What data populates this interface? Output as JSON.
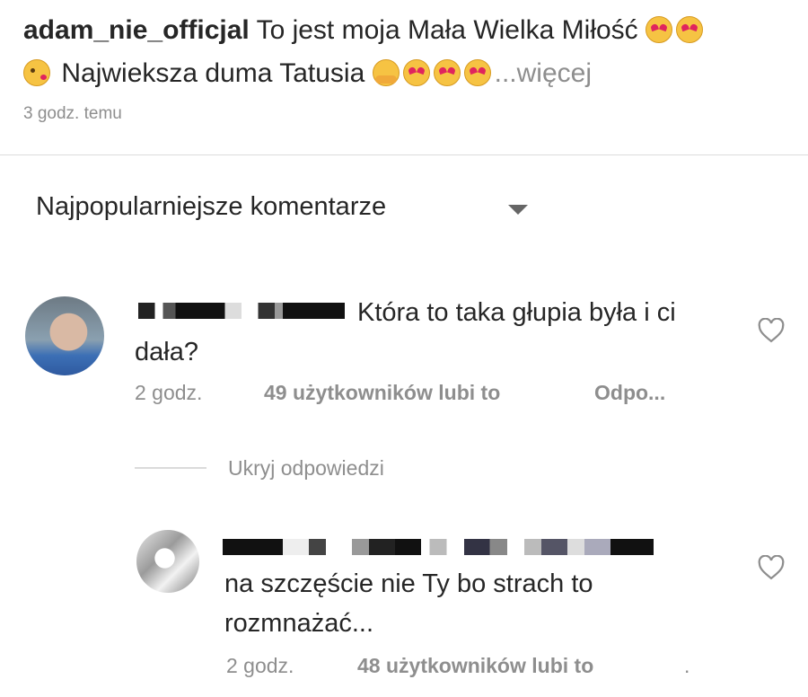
{
  "post": {
    "username": "adam_nie_officjal",
    "caption_part1": "To jest moja Mała Wielka Miłość",
    "caption_part2": "Najwieksza duma Tatusia",
    "more": "...więcej",
    "time_ago": "3 godz. temu",
    "emojis_line1": [
      "heart-eyes-emoji",
      "smiling-face-with-hearts-emoji"
    ],
    "emojis_line2_start": [
      "face-blowing-kiss-emoji"
    ],
    "emojis_line2_end": [
      "hugging-face-emoji",
      "heart-eyes-emoji",
      "heart-eyes-emoji",
      "heart-eyes-emoji"
    ]
  },
  "comments_header": {
    "sort_label": "Najpopularniejsze komentarze",
    "caret_icon": "chevron-down-icon"
  },
  "comments": [
    {
      "text": "Która to taka głupia była i ci dała?",
      "time": "2 godz.",
      "likes": "49 użytkowników lubi to",
      "reply": "Odpo...",
      "like_icon": "heart-outline-icon"
    }
  ],
  "replies_toggle": "Ukryj odpowiedzi",
  "replies": [
    {
      "text": "na szczęście nie Ty bo strach to rozmnażać...",
      "time": "2 godz.",
      "likes": "48 użytkowników lubi to",
      "trailing": ".",
      "like_icon": "heart-outline-icon"
    }
  ],
  "colors": {
    "text": "#262626",
    "secondary": "#8e8e8e",
    "divider": "#dbdbdb"
  }
}
